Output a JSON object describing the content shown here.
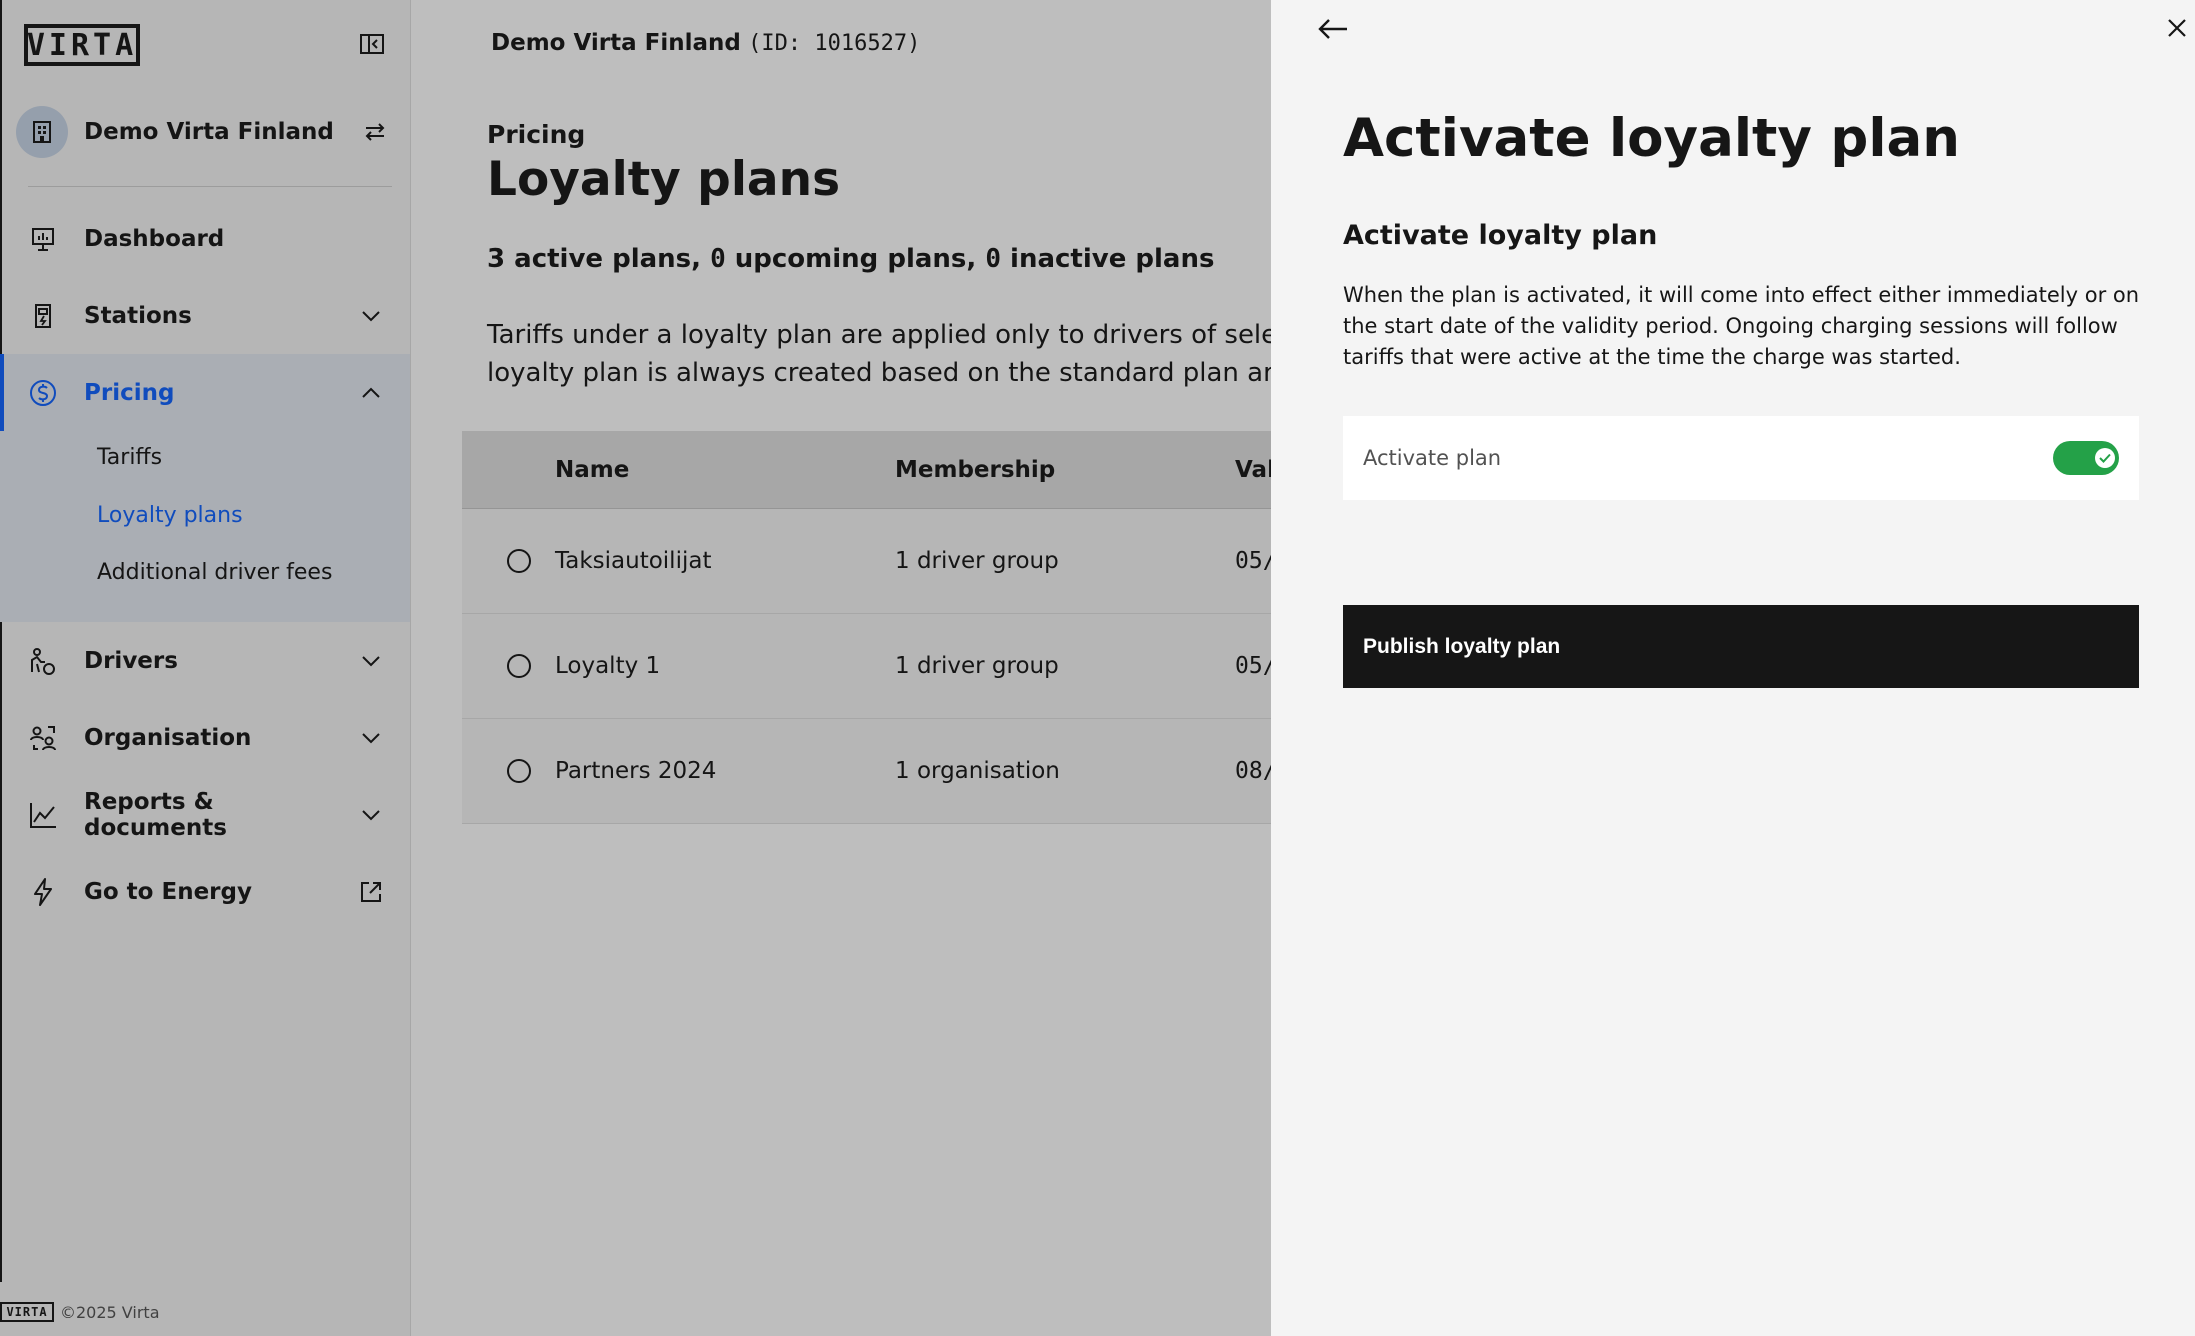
{
  "brand": {
    "logo_text": "VIRTA",
    "footer_text": "©2025 Virta"
  },
  "sidebar": {
    "org_name": "Demo Virta Finland",
    "nav": [
      {
        "label": "Dashboard",
        "icon": "dashboard-icon"
      },
      {
        "label": "Stations",
        "icon": "station-icon"
      },
      {
        "label": "Pricing",
        "icon": "pricing-icon"
      },
      {
        "label": "Drivers",
        "icon": "drivers-icon"
      },
      {
        "label": "Organisation",
        "icon": "organisation-icon"
      },
      {
        "label": "Reports & documents",
        "icon": "reports-icon"
      },
      {
        "label": "Go to Energy",
        "icon": "energy-icon"
      }
    ],
    "pricing_sub": [
      {
        "label": "Tariffs"
      },
      {
        "label": "Loyalty plans"
      },
      {
        "label": "Additional driver fees"
      }
    ]
  },
  "main": {
    "org_header_name": "Demo Virta Finland",
    "org_header_id": "(ID: 1016527)",
    "eyebrow": "Pricing",
    "title": "Loyalty plans",
    "summary": {
      "active": "3",
      "active_label": " active plans, ",
      "upcoming": "0",
      "upcoming_label": " upcoming plans, ",
      "inactive": "0",
      "inactive_label": " inactive plans"
    },
    "description_line1": "Tariffs under a loyalty plan are applied only to drivers of selected org",
    "description_line2": "loyalty plan is always created based on the standard plan and therefo",
    "table": {
      "headers": [
        "Name",
        "Membership",
        "Vali"
      ],
      "rows": [
        {
          "name": "Taksiautoilijat",
          "membership": "1 driver group",
          "valid": "05/"
        },
        {
          "name": "Loyalty 1",
          "membership": "1 driver group",
          "valid": "05/"
        },
        {
          "name": "Partners 2024",
          "membership": "1 organisation",
          "valid": "08/"
        }
      ]
    }
  },
  "drawer": {
    "title": "Activate loyalty plan",
    "subtitle": "Activate loyalty plan",
    "body": "When the plan is activated, it will come into effect either immediately or on the start date of the validity period. Ongoing charging sessions will follow tariffs that were active at the time the charge was started.",
    "toggle_label": "Activate plan",
    "toggle_on": true,
    "publish_label": "Publish loyalty plan"
  },
  "colors": {
    "accent": "#0f62fe",
    "toggle_on": "#24a148",
    "primary_button": "#161616"
  }
}
